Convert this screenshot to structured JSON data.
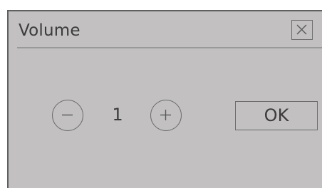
{
  "dialog": {
    "title": "Volume",
    "close_icon": "close-icon",
    "volume": {
      "decrease_icon": "minus-circle-icon",
      "value": "1",
      "increase_icon": "plus-circle-icon"
    },
    "ok_label": "OK"
  },
  "colors": {
    "dialog_background": "#c2c0c1",
    "border": "#5f5f5f",
    "text": "#3b3b3b",
    "divider": "#999999"
  }
}
